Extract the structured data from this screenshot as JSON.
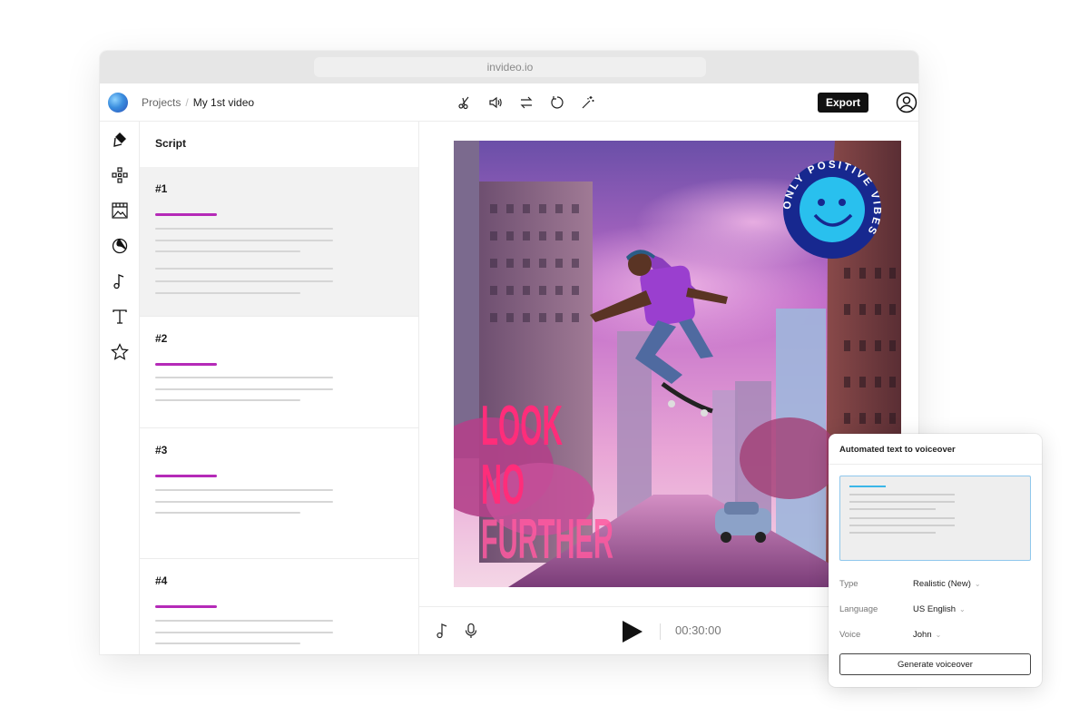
{
  "browser": {
    "url": "invideo.io"
  },
  "header": {
    "breadcrumb": [
      "Projects",
      "My 1st video"
    ],
    "breadcrumb_separator": "/",
    "tools": [
      "scissors-icon",
      "volume-icon",
      "swap-icon",
      "rotate-icon",
      "magic-wand-icon"
    ],
    "export_label": "Export"
  },
  "sidebar": {
    "icons": [
      "brand-kit-icon",
      "elements-icon",
      "media-icon",
      "stickers-icon",
      "music-icon",
      "text-icon",
      "favorites-icon"
    ]
  },
  "script": {
    "title": "Script",
    "scenes": [
      {
        "label": "#1",
        "active": true
      },
      {
        "label": "#2",
        "active": false
      },
      {
        "label": "#3",
        "active": false
      },
      {
        "label": "#4",
        "active": false
      }
    ]
  },
  "canvas": {
    "headline": [
      "LOOK",
      "NO",
      "FURTHER"
    ],
    "badge_text": "ONLY POSITIVE VIBES"
  },
  "player": {
    "timecode": "00:30:00"
  },
  "voiceover": {
    "title": "Automated text to voiceover",
    "type_label": "Type",
    "type_value": "Realistic (New)",
    "language_label": "Language",
    "language_value": "US English",
    "voice_label": "Voice",
    "voice_value": "John",
    "generate_label": "Generate voiceover"
  },
  "colors": {
    "accent": "#b52ab8",
    "highlight": "#3ab6e8",
    "export_bg": "#111111"
  }
}
